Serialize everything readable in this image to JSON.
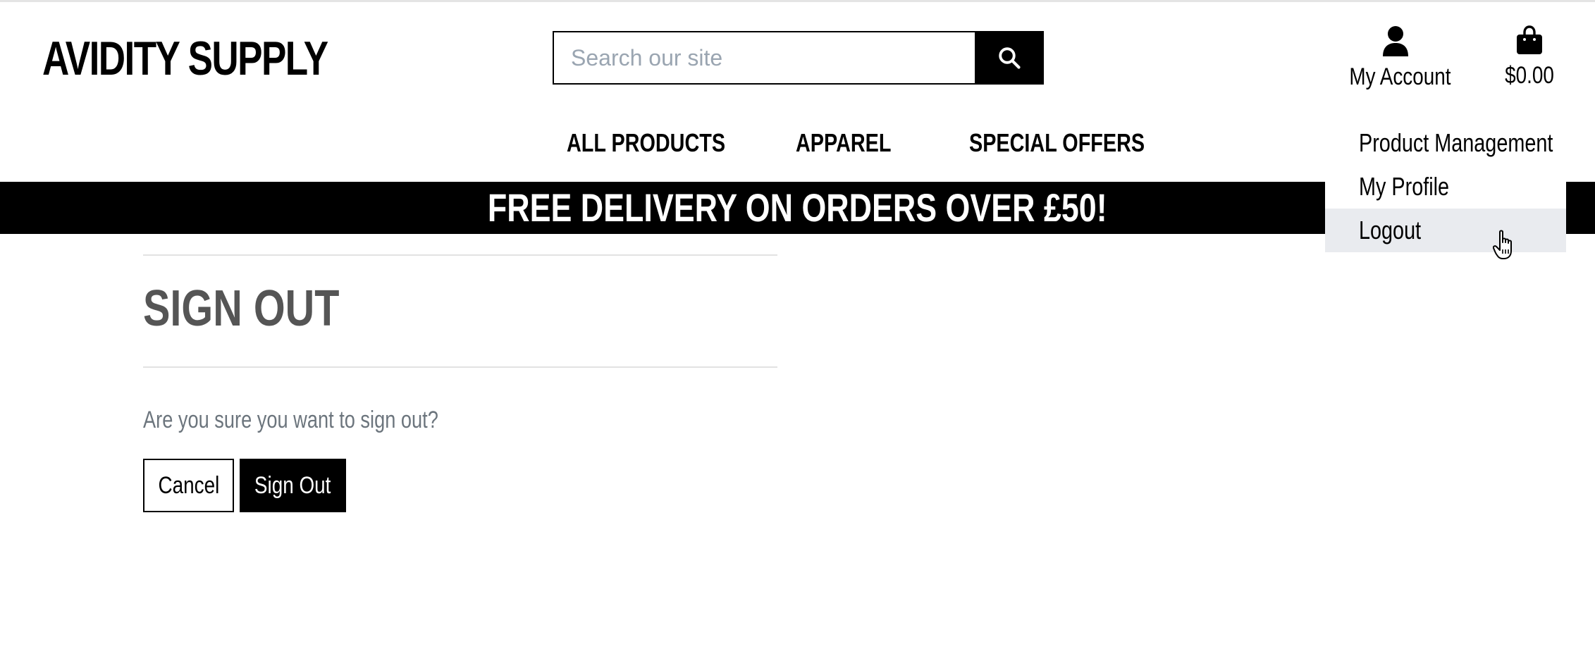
{
  "header": {
    "brand": "AVIDITY SUPPLY",
    "search": {
      "placeholder": "Search our site",
      "value": "",
      "button_icon": "search-icon"
    },
    "account": {
      "icon": "user-icon",
      "label": "My Account"
    },
    "cart": {
      "icon": "shopping-bag-icon",
      "total": "$0.00"
    }
  },
  "nav": {
    "items": [
      {
        "label": "ALL PRODUCTS"
      },
      {
        "label": "APPAREL"
      },
      {
        "label": "SPECIAL OFFERS"
      }
    ]
  },
  "account_menu": {
    "items": [
      {
        "label": "Product Management"
      },
      {
        "label": "My Profile"
      },
      {
        "label": "Logout",
        "hovered": true
      }
    ]
  },
  "banner": {
    "text": "FREE DELIVERY ON ORDERS OVER £50!"
  },
  "main": {
    "title": "SIGN OUT",
    "question": "Are you sure you want to sign out?",
    "cancel_label": "Cancel",
    "signout_label": "Sign Out"
  },
  "colors": {
    "primary": "#000000",
    "title_gray": "#555555",
    "muted_text": "#6c757d",
    "hover_bg": "#e9ebef",
    "placeholder": "#9aa5b1"
  }
}
